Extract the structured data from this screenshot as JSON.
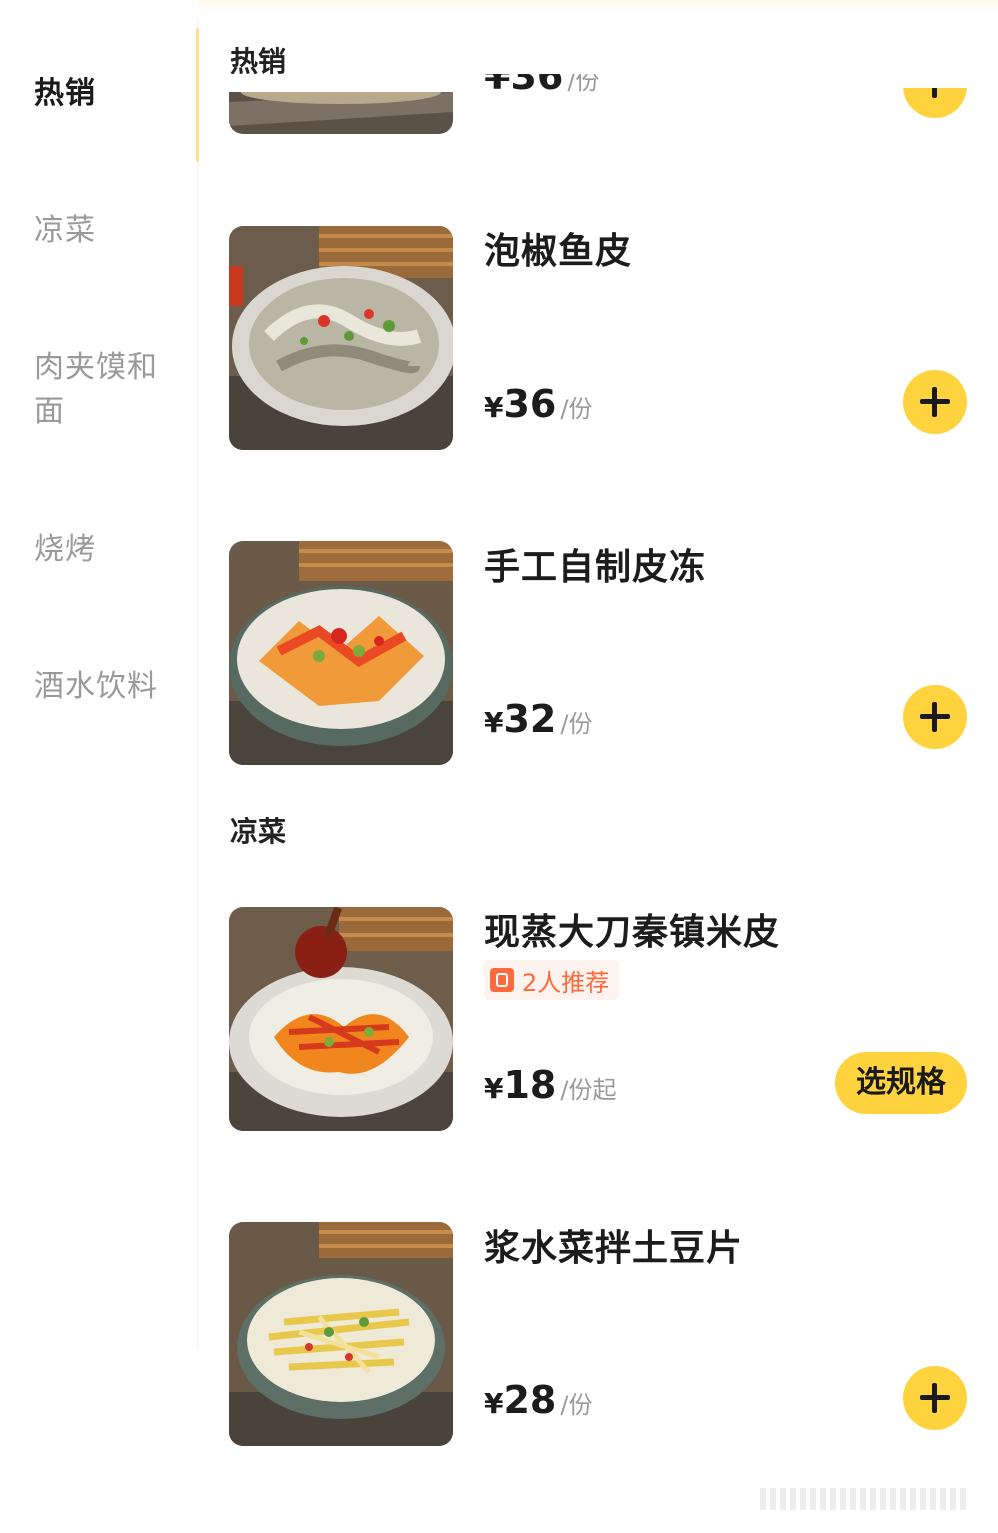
{
  "sidebar": {
    "categories": [
      {
        "label": "热销",
        "active": true
      },
      {
        "label": "凉菜",
        "active": false
      },
      {
        "label": "肉夹馍和面",
        "active": false
      },
      {
        "label": "烧烤",
        "active": false
      },
      {
        "label": "酒水饮料",
        "active": false
      }
    ]
  },
  "sections": {
    "hot": "热销",
    "cold": "凉菜"
  },
  "partial_item": {
    "price_fragment": "¥36",
    "unit": "/份"
  },
  "items": [
    {
      "name": "泡椒鱼皮",
      "currency": "¥",
      "price": "36",
      "unit": "/份",
      "action": "add"
    },
    {
      "name": "手工自制皮冻",
      "currency": "¥",
      "price": "32",
      "unit": "/份",
      "action": "add"
    },
    {
      "name": "现蒸大刀秦镇米皮",
      "currency": "¥",
      "price": "18",
      "unit": "/份起",
      "badge": "2人推荐",
      "action_label": "选规格"
    },
    {
      "name": "浆水菜拌土豆片",
      "currency": "¥",
      "price": "28",
      "unit": "/份",
      "action": "add"
    }
  ],
  "colors": {
    "accent": "#ffd33d",
    "badge": "#ff6a3d",
    "muted": "#9a9a9a"
  },
  "icons": [
    "plus-icon",
    "recommend-icon"
  ]
}
